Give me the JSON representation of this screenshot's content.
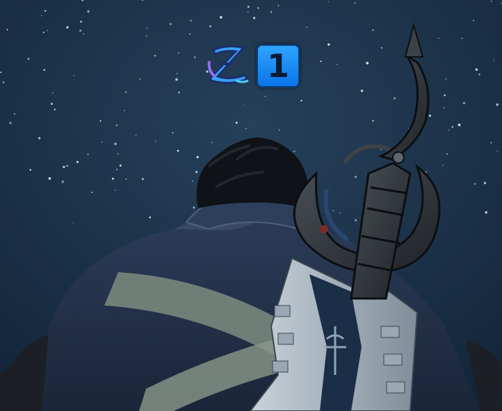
{
  "hud": {
    "status_effect": {
      "icon": "sleep-z-icon",
      "stacks": "1",
      "accent_color": "#2d8cf0",
      "badge_color": "#1a8df5"
    }
  },
  "scene": {
    "sky_color": "#1d3346",
    "coat_color": "#23324a"
  }
}
